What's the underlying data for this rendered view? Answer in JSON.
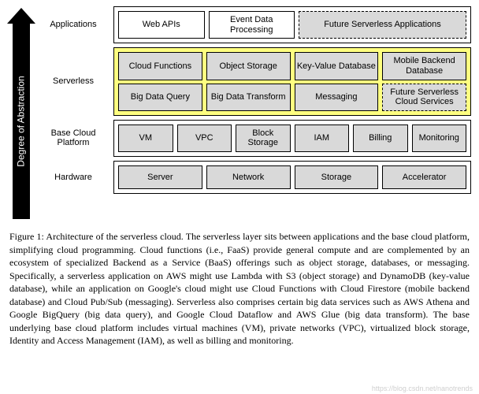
{
  "axis_label": "Degree of Abstraction",
  "layers": {
    "applications": {
      "label": "Applications",
      "row1": [
        "Web APIs",
        "Event Data Processing",
        "Future Serverless Applications"
      ]
    },
    "serverless": {
      "label": "Serverless",
      "row1": [
        "Cloud Functions",
        "Object Storage",
        "Key-Value Database",
        "Mobile Backend Database"
      ],
      "row2": [
        "Big Data Query",
        "Big Data Transform",
        "Messaging",
        "Future Serverless Cloud Services"
      ]
    },
    "base": {
      "label": "Base Cloud Platform",
      "row1": [
        "VM",
        "VPC",
        "Block Storage",
        "IAM",
        "Billing",
        "Monitoring"
      ]
    },
    "hardware": {
      "label": "Hardware",
      "row1": [
        "Server",
        "Network",
        "Storage",
        "Accelerator"
      ]
    }
  },
  "caption": "Figure 1: Architecture of the serverless cloud. The serverless layer sits between applications and the base cloud platform, simplifying cloud programming. Cloud functions (i.e., FaaS) provide general compute and are complemented by an ecosystem of specialized Backend as a Service (BaaS) offerings such as object storage, databases, or messaging. Specifically, a serverless application on AWS might use Lambda with S3 (object storage) and DynamoDB (key-value database), while an application on Google's cloud might use Cloud Functions with Cloud Firestore (mobile backend database) and Cloud Pub/Sub (messaging). Serverless also comprises certain big data services such as AWS Athena and Google BigQuery (big data query), and Google Cloud Dataflow and AWS Glue (big data transform). The base underlying base cloud platform includes virtual machines (VM), private networks (VPC), virtualized block storage, Identity and Access Management (IAM), as well as billing and monitoring.",
  "watermark": "https://blog.csdn.net/nanotrends"
}
